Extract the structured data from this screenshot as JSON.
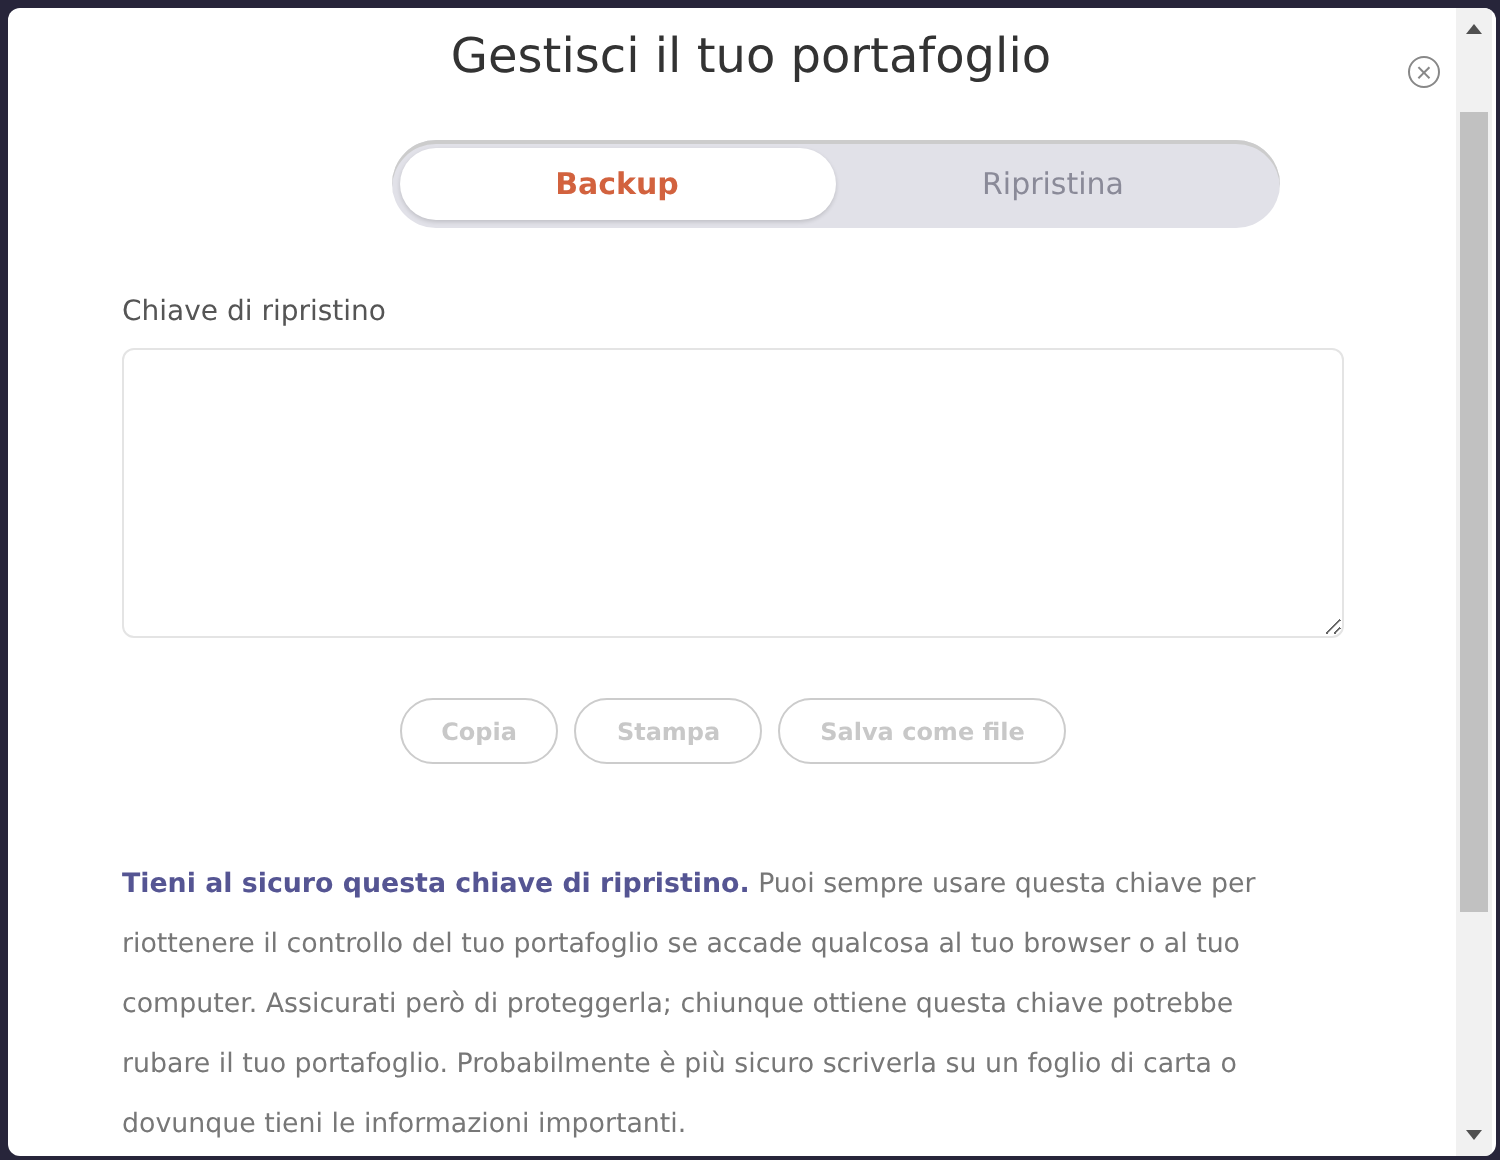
{
  "dialog": {
    "title": "Gestisci il tuo portafoglio",
    "close": "×"
  },
  "tabs": [
    {
      "label": "Backup",
      "selected": true
    },
    {
      "label": "Ripristina",
      "selected": false
    }
  ],
  "key_field": {
    "label": "Chiave di ripristino"
  },
  "buttons": [
    {
      "label": "Copia",
      "disabled": true
    },
    {
      "label": "Stampa",
      "disabled": true
    },
    {
      "label": "Salva come file",
      "disabled": true
    }
  ],
  "notice": "**Tieni al sicuro questa chiave di ripristino.** Puoi sempre usare questa chiave per riottenere il controllo del tuo portafoglio se accade qualcosa al tuo browser o al tuo computer. Assicurati però di proteggerla; chiunque ottiene questa chiave potrebbe rubare il tuo portafoglio. Probabilmente è più sicuro scriverla su un foglio di carta o dovunque tieni le informazioni importanti."
}
